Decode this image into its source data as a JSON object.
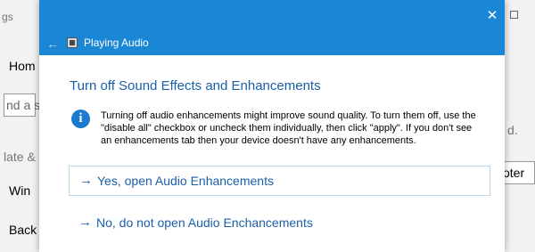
{
  "background_window": {
    "title_fragment": "gs",
    "nav_home": "Hom",
    "search_fragment": "nd a s",
    "section_fragment": "late &",
    "nav_windows": "Win",
    "nav_backup": "Back",
    "right_text": "d.",
    "right_input": "oter"
  },
  "dialog": {
    "title": "Playing Audio",
    "heading": "Turn off Sound Effects and Enhancements",
    "info_text": "Turning off audio enhancements might improve sound quality. To turn them off, use the \"disable all\" checkbox or uncheck them individually, then click \"apply\". If you don't see an enhancements tab then your device doesn't have any enhancements.",
    "options": [
      {
        "arrow": "→",
        "label": "Yes, open Audio Enhancements"
      },
      {
        "arrow": "→",
        "label": "No, do not open Audio Enchancements"
      }
    ],
    "close_glyph": "✕",
    "back_glyph": "←",
    "info_glyph": "i"
  },
  "colors": {
    "accent": "#1a87d6",
    "link": "#1a5fa8"
  }
}
